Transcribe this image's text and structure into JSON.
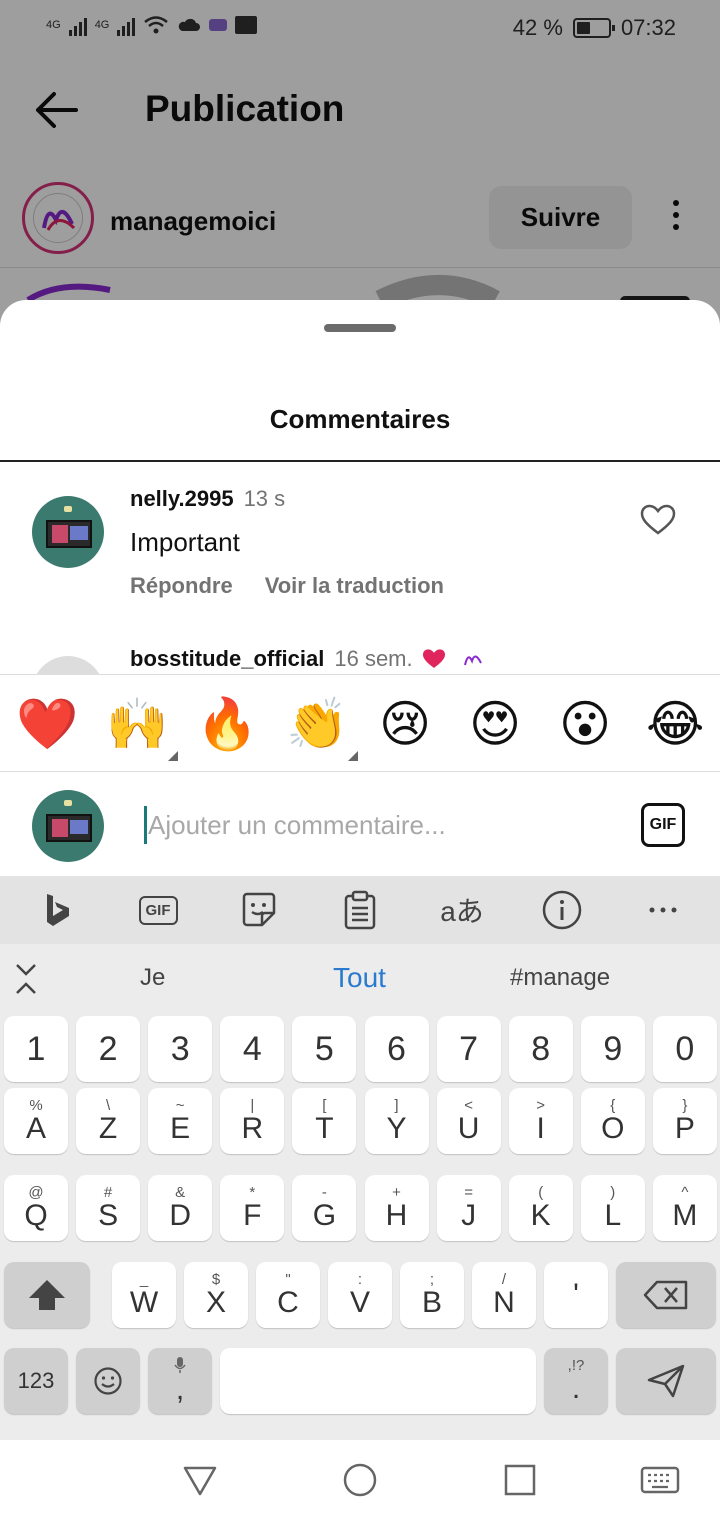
{
  "status_bar": {
    "network_1": "4G",
    "network_2": "4G",
    "battery": "42 %",
    "battery_level": 0.42,
    "time": "07:32"
  },
  "header": {
    "title": "Publication",
    "back_icon": "arrow-left-icon"
  },
  "post_author": {
    "username": "managemoici",
    "follow_label": "Suivre"
  },
  "comments_sheet": {
    "title": "Commentaires",
    "comments": [
      {
        "username": "nelly.2995",
        "time": "13 s",
        "text": "Important",
        "reply_label": "Répondre",
        "translate_label": "Voir la traduction"
      },
      {
        "username": "bosstitude_official",
        "time": "16 sem.",
        "text": "",
        "reply_label": "",
        "translate_label": ""
      }
    ],
    "quick_emojis": [
      "❤️",
      "🙌",
      "🔥",
      "👏",
      "😢",
      "😍",
      "😮",
      "😂"
    ],
    "compose": {
      "placeholder": "Ajouter un commentaire...",
      "gif_label": "GIF"
    }
  },
  "keyboard": {
    "toolbar": [
      "bing-icon",
      "gif-icon",
      "sticker-icon",
      "clipboard-icon",
      "translate-icon",
      "info-icon",
      "more-icon"
    ],
    "toolbar_gif_label": "GIF",
    "translate_glyph": "aあ",
    "suggestions": [
      "Je",
      "Tout",
      "#manage"
    ],
    "number_row": [
      "1",
      "2",
      "3",
      "4",
      "5",
      "6",
      "7",
      "8",
      "9",
      "0"
    ],
    "row1": [
      {
        "sym": "%",
        "key": "A"
      },
      {
        "sym": "\\",
        "key": "Z"
      },
      {
        "sym": "~",
        "key": "E"
      },
      {
        "sym": "|",
        "key": "R"
      },
      {
        "sym": "[",
        "key": "T"
      },
      {
        "sym": "]",
        "key": "Y"
      },
      {
        "sym": "<",
        "key": "U"
      },
      {
        "sym": ">",
        "key": "I"
      },
      {
        "sym": "{",
        "key": "O"
      },
      {
        "sym": "}",
        "key": "P"
      }
    ],
    "row2": [
      {
        "sym": "@",
        "key": "Q"
      },
      {
        "sym": "#",
        "key": "S"
      },
      {
        "sym": "&",
        "key": "D"
      },
      {
        "sym": "*",
        "key": "F"
      },
      {
        "sym": "-",
        "key": "G"
      },
      {
        "sym": "+",
        "key": "H"
      },
      {
        "sym": "=",
        "key": "J"
      },
      {
        "sym": "(",
        "key": "K"
      },
      {
        "sym": ")",
        "key": "L"
      },
      {
        "sym": "^",
        "key": "M"
      }
    ],
    "row3": [
      {
        "sym": "_",
        "key": "W"
      },
      {
        "sym": "$",
        "key": "X"
      },
      {
        "sym": "\"",
        "key": "C"
      },
      {
        "sym": ":",
        "key": "V"
      },
      {
        "sym": ";",
        "key": "B"
      },
      {
        "sym": "/",
        "key": "N"
      },
      {
        "sym": "",
        "key": "'"
      }
    ],
    "bottom": {
      "numbers_label": "123",
      "comma_label": ",",
      "period_sym": ",!?",
      "period_label": "."
    }
  },
  "colors": {
    "accent_blue": "#2a7bd0",
    "like_red": "#e0245e",
    "caret": "#1a7a7a"
  }
}
